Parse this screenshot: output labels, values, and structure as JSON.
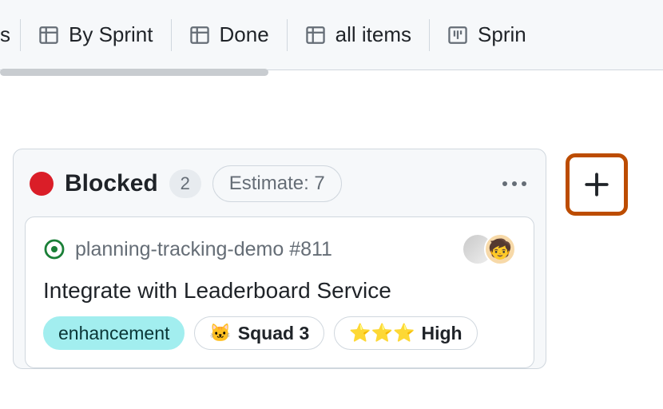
{
  "tabs": {
    "left_fragment": "s",
    "items": [
      {
        "label": "By Sprint",
        "icon": "table"
      },
      {
        "label": "Done",
        "icon": "table"
      },
      {
        "label": "all items",
        "icon": "table"
      },
      {
        "label": "Sprin",
        "icon": "board"
      }
    ]
  },
  "column": {
    "status_color": "#da1e28",
    "title": "Blocked",
    "count": "2",
    "estimate_label": "Estimate: 7"
  },
  "card": {
    "repo_ref": "planning-tracking-demo #811",
    "title": "Integrate with Leaderboard Service",
    "labels": {
      "enhancement": "enhancement",
      "squad": {
        "emoji": "🐱",
        "text": "Squad 3"
      },
      "priority": {
        "emoji": "⭐⭐⭐",
        "text": "High"
      }
    }
  }
}
